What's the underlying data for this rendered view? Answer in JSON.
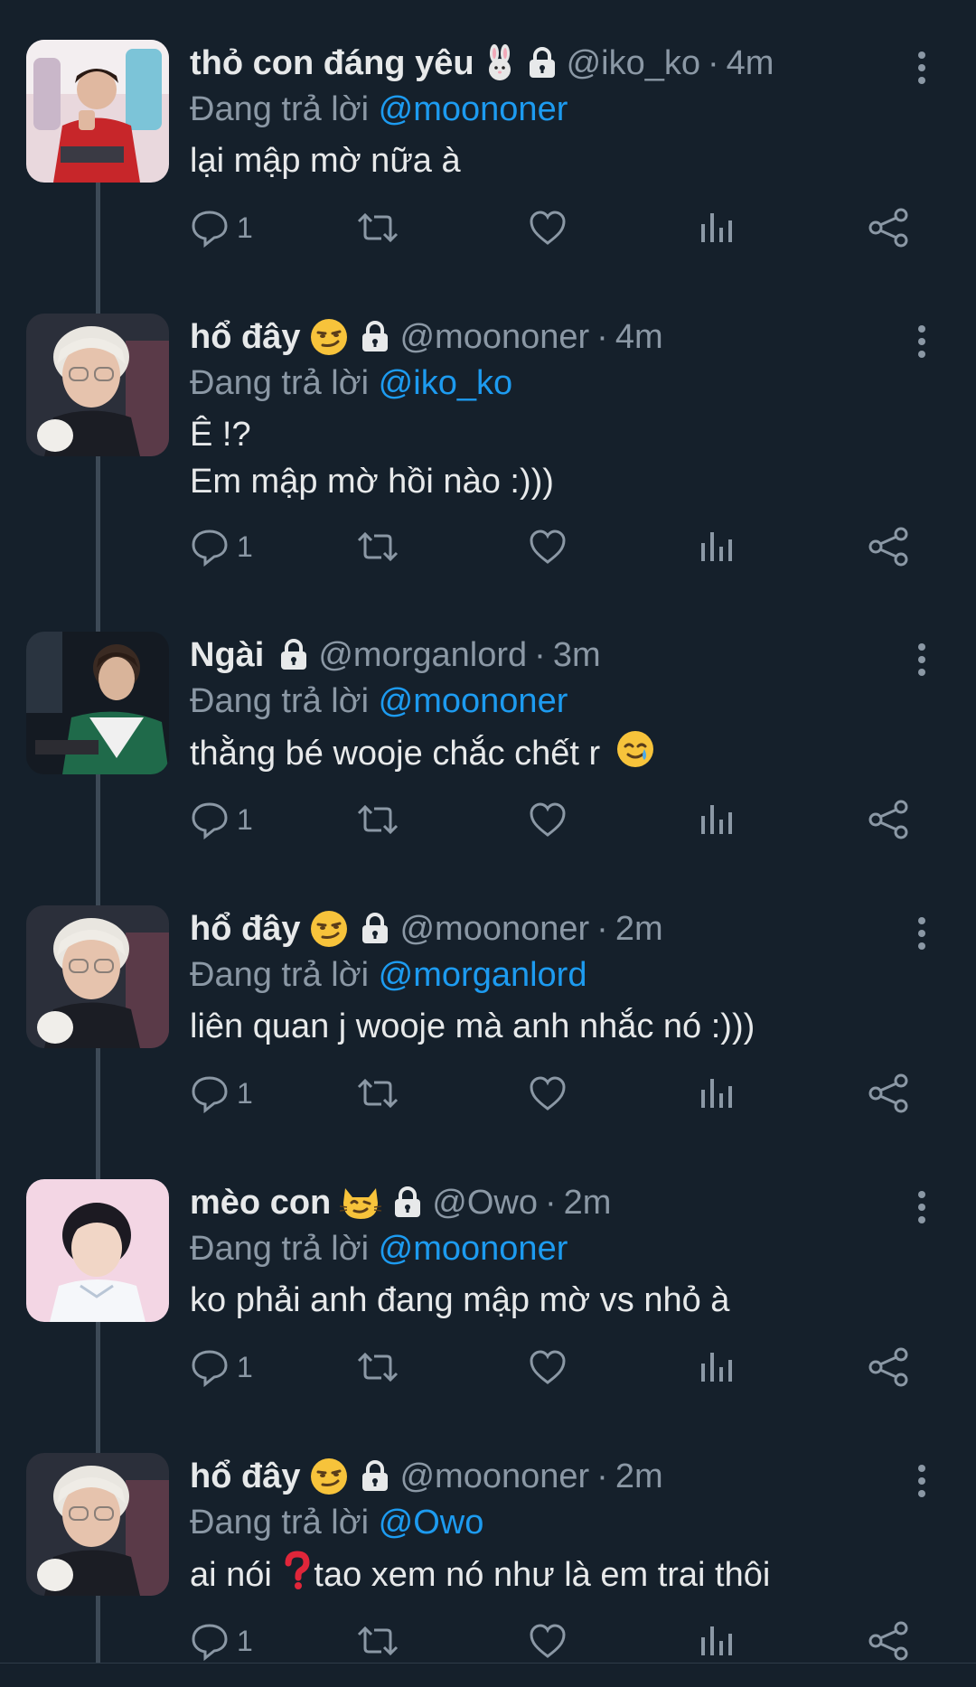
{
  "tweets": [
    {
      "name": "thỏ con đáng yêu",
      "emoji": "rabbit-icon",
      "handle": "@iko_ko",
      "time": "4m",
      "reply_prefix": "Đang trả lời",
      "reply_to": "@moononer",
      "lines": [
        "lại mập mờ nữa à"
      ],
      "reply_count": "1"
    },
    {
      "name": "hổ đây",
      "emoji": "smirk-face-icon",
      "handle": "@moononer",
      "time": "4m",
      "reply_prefix": "Đang trả lời",
      "reply_to": "@iko_ko",
      "lines": [
        "Ê !?",
        "Em mập mờ hồi nào :)))"
      ],
      "reply_count": "1"
    },
    {
      "name": "Ngài",
      "emoji": "",
      "handle": "@morganlord",
      "time": "3m",
      "reply_prefix": "Đang trả lời",
      "reply_to": "@moononer",
      "lines": [
        "thằng bé wooje chắc chết r"
      ],
      "trailing_emoji": "smiling-tear-face-icon",
      "reply_count": "1"
    },
    {
      "name": "hổ đây",
      "emoji": "smirk-face-icon",
      "handle": "@moononer",
      "time": "2m",
      "reply_prefix": "Đang trả lời",
      "reply_to": "@morganlord",
      "lines": [
        "liên quan j wooje mà anh nhắc nó :)))"
      ],
      "reply_count": "1"
    },
    {
      "name": "mèo con",
      "emoji": "cat-face-icon",
      "handle": "@Owo",
      "time": "2m",
      "reply_prefix": "Đang trả lời",
      "reply_to": "@moononer",
      "lines": [
        "ko phải anh đang mập mờ vs nhỏ à"
      ],
      "reply_count": "1"
    },
    {
      "name": "hổ đây",
      "emoji": "smirk-face-icon",
      "handle": "@moononer",
      "time": "2m",
      "reply_prefix": "Đang trả lời",
      "reply_to": "@Owo",
      "line_before_emoji": "ai nói ",
      "inline_emoji": "red-question-mark-icon",
      "line_after_emoji": "tao xem nó như là em trai thôi",
      "reply_count": "1"
    }
  ],
  "colors": {
    "background": "#15202b",
    "text": "#e7e9ea",
    "muted": "#8b98a5",
    "link": "#1d9bf0",
    "thread_line": "#3d4a57"
  }
}
